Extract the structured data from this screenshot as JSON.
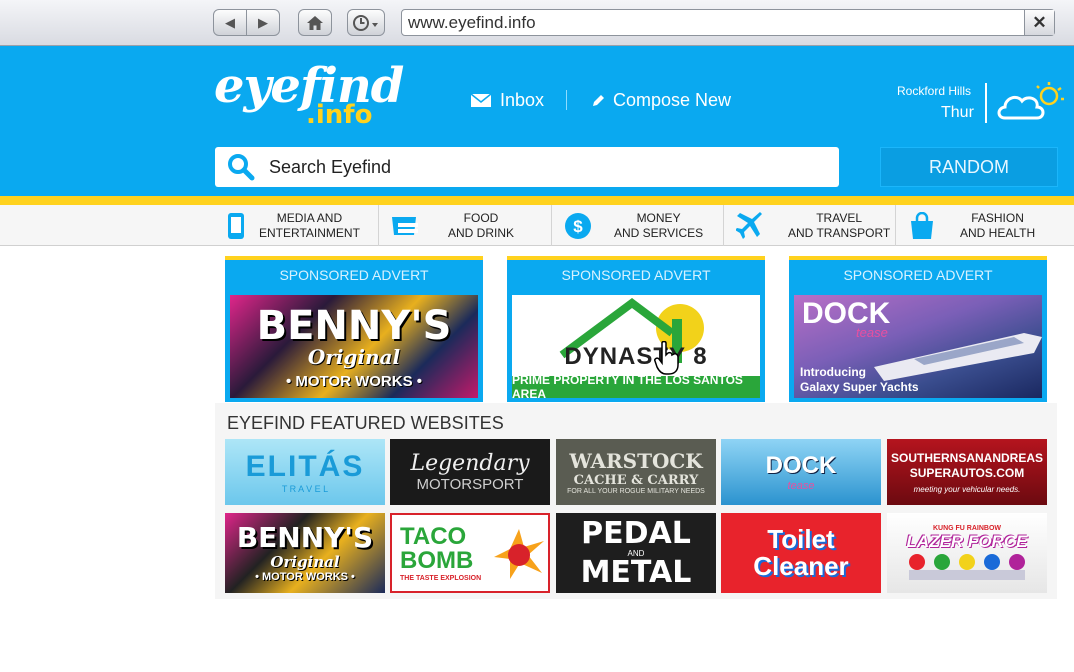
{
  "browser": {
    "back_label": "◀",
    "forward_label": "▶",
    "url": "www.eyefind.info",
    "close_label": "✕"
  },
  "site": {
    "logo_main": "eyefind",
    "logo_sub": ".info",
    "inbox_label": "Inbox",
    "compose_label": "Compose New",
    "search_placeholder": "Search Eyefind",
    "random_label": "RANDOM",
    "weather": {
      "location": "Rockford Hills",
      "day": "Thur",
      "icon": "cloud-sun-icon"
    }
  },
  "categories": [
    {
      "label": "MEDIA AND\nENTERTAINMENT",
      "icon": "phone-icon"
    },
    {
      "label": "FOOD\nAND DRINK",
      "icon": "food-icon"
    },
    {
      "label": "MONEY\nAND SERVICES",
      "icon": "dollar-icon"
    },
    {
      "label": "TRAVEL\nAND TRANSPORT",
      "icon": "plane-icon"
    },
    {
      "label": "FASHION\nAND HEALTH",
      "icon": "bag-icon"
    }
  ],
  "sponsored": [
    {
      "title": "SPONSORED ADVERT",
      "brand_line1": "BENNY'S",
      "brand_line2": "Original",
      "brand_line3": "• MOTOR WORKS •"
    },
    {
      "title": "SPONSORED ADVERT",
      "brand": "DYNASTY 8",
      "tagline": "PRIME PROPERTY IN THE LOS SANTOS AREA"
    },
    {
      "title": "SPONSORED ADVERT",
      "brand": "DOCK",
      "brand_sub": "tease",
      "line1": "Introducing",
      "line2": "Galaxy Super Yachts"
    }
  ],
  "featured": {
    "title": "EYEFIND FEATURED WEBSITES",
    "tiles": [
      {
        "line1": "ELITÁS",
        "line2": "T R A V E L"
      },
      {
        "line1": "Legendary",
        "line2": "MOTORSPORT"
      },
      {
        "line1": "WARSTOCK",
        "line2": "CACHE & CARRY",
        "line3": "FOR ALL YOUR ROGUE MILITARY NEEDS"
      },
      {
        "line1": "DOCK",
        "line2": "tease"
      },
      {
        "line1": "SOUTHERNSANANDREAS SUPERAUTOS.COM",
        "line2": "meeting your vehicular needs."
      },
      {
        "line1": "BENNY'S",
        "line2": "Original",
        "line3": "• MOTOR WORKS •"
      },
      {
        "line1": "TACO BOMB",
        "line2": "THE TASTE EXPLOSION"
      },
      {
        "line1": "PEDAL",
        "line2": "AND",
        "line3": "METAL"
      },
      {
        "line1": "Toilet",
        "line2": "Cleaner"
      },
      {
        "line1": "KUNG FU RAINBOW",
        "line2": "LAZER FORCE"
      }
    ]
  },
  "colors": {
    "brand_blue": "#0aa9f0",
    "brand_yellow": "#ffd21e"
  }
}
